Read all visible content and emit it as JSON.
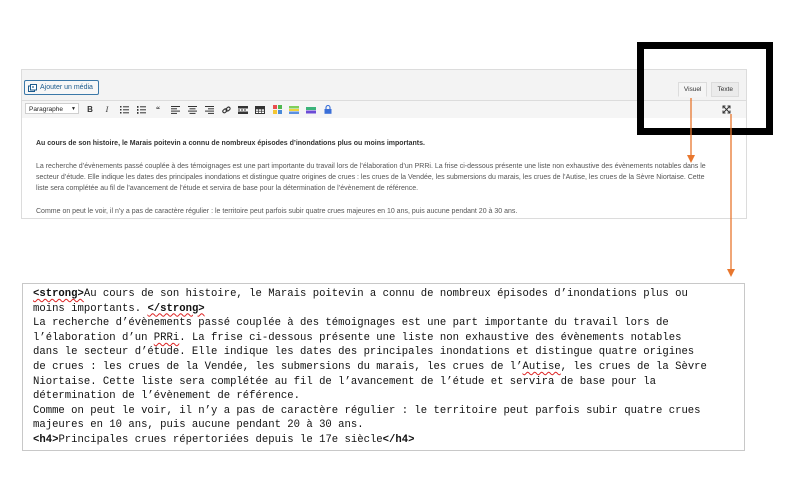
{
  "editor": {
    "add_media_label": "Ajouter un média",
    "tabs": [
      {
        "label": "Visuel",
        "active": true
      },
      {
        "label": "Texte",
        "active": false
      }
    ],
    "format_select": "Paragraphe",
    "toolbar_icons": [
      "bold-icon",
      "italic-icon",
      "bullet-list-icon",
      "numbered-list-icon",
      "blockquote-icon",
      "align-left-icon",
      "align-center-icon",
      "align-right-icon",
      "link-icon",
      "insert-more-icon",
      "table-icon",
      "table-color-icon",
      "colors-icon",
      "highlight-icon",
      "lock-icon"
    ],
    "content": {
      "heading": "Au cours de son histoire, le Marais poitevin a connu de nombreux épisodes d’inondations plus ou moins importants.",
      "paragraph": "La recherche d’évènements passé couplée à des témoignages est une part importante du travail lors de l’élaboration d’un PRRi. La frise ci-dessous présente une liste non exhaustive des évènements notables dans le secteur d’étude. Elle indique les dates des principales inondations et distingue quatre origines de crues : les crues de la Vendée, les submersions du marais, les crues de l’Autise, les crues de la Sèvre Niortaise. Cette liste sera complétée au fil de l’avancement de l’étude et servira de base pour la détermination de l’évènement de référence.",
      "trailing": "Comme on peut le voir, il n’y a pas de caractère régulier : le territoire peut parfois subir quatre crues majeures en 10 ans, puis aucune pendant 20 à 30 ans."
    }
  },
  "code": {
    "l1": {
      "tag": "<strong>",
      "text": "Au cours de son histoire, le Marais poitevin a connu de nombreux épisodes d’inondations plus ou"
    },
    "l2": {
      "text": "moins importants. ",
      "tag": "</strong>"
    },
    "l3": "La recherche d’évènements passé couplée à des témoignages est une part importante du travail lors de",
    "l4a": "l’élaboration d’un ",
    "l4b": "PRRi",
    "l4c": ". La frise ci-dessous présente une liste non exhaustive des évènements notables",
    "l5": "dans le secteur d’étude. Elle indique les dates des principales inondations et distingue quatre origines",
    "l6a": "de crues : les crues de la Vendée, les submersions du marais, les crues de l’",
    "l6b": "Autise",
    "l6c": ", les crues de la Sèvre",
    "l7": "Niortaise. Cette liste sera complétée au fil de l’avancement de l’étude et servira de base pour la",
    "l8": "détermination de l’évènement de référence.",
    "l9": "Comme on peut le voir, il n’y a pas de caractère régulier : le territoire peut parfois subir quatre crues",
    "l10": "majeures en 10 ans, puis aucune pendant 20 à 30 ans.",
    "l11": {
      "open": "<h4>",
      "text": "Principales crues répertoriées depuis le 17e siècle",
      "close": "</h4>"
    }
  },
  "colors": {
    "arrow": "#e8772e",
    "annotation_box": "#000000",
    "link_blue": "#1d5b8d"
  }
}
